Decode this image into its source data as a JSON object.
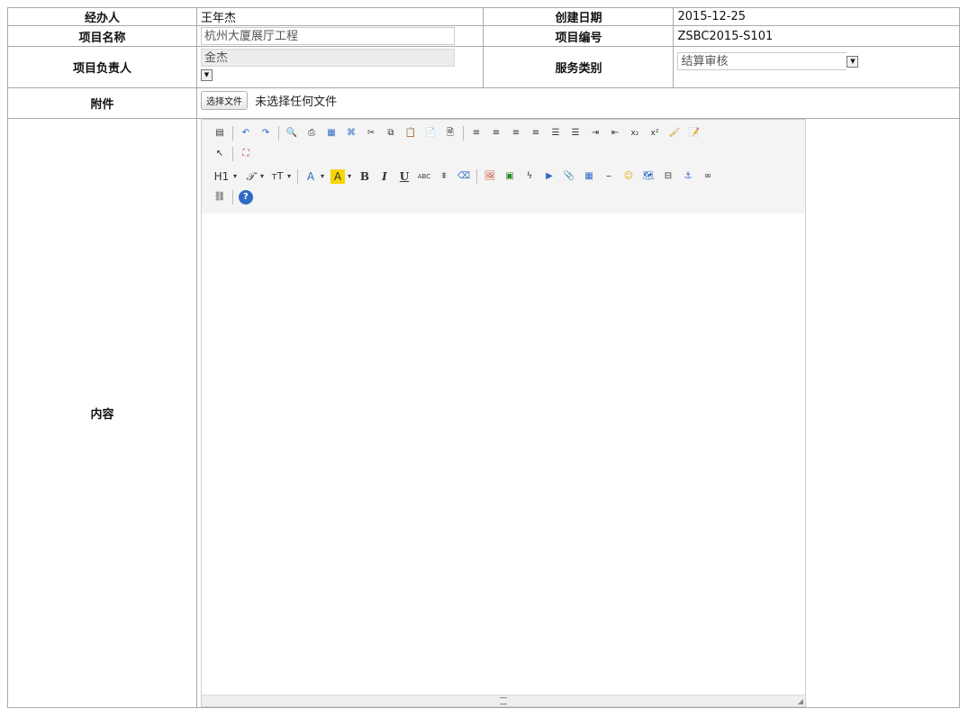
{
  "form": {
    "handler_label": "经办人",
    "handler_value": "王年杰",
    "created_label": "创建日期",
    "created_value": "2015-12-25",
    "project_name_label": "项目名称",
    "project_name_value": "杭州大厦展厅工程",
    "project_code_label": "项目编号",
    "project_code_value": "ZSBC2015-S101",
    "leader_label": "项目负责人",
    "leader_value": "金杰",
    "service_label": "服务类别",
    "service_value": "结算审核",
    "attachment_label": "附件",
    "attachment_button": "选择文件",
    "attachment_status": "未选择任何文件",
    "content_label": "内容"
  },
  "editor": {
    "toolbar_row1": [
      "source-icon",
      "undo-icon",
      "redo-icon",
      "preview-icon",
      "print-icon",
      "template-icon",
      "code-icon",
      "cut-icon",
      "copy-icon",
      "paste-icon",
      "paste-text-icon",
      "paste-word-icon",
      "align-left-icon",
      "align-center-icon",
      "align-right-icon",
      "justify-icon",
      "ordered-list-icon",
      "unordered-list-icon",
      "indent-icon",
      "outdent-icon",
      "subscript-icon",
      "superscript-icon",
      "clear-format-icon",
      "select-all-icon"
    ],
    "toolbar_row2": [
      "select-icon",
      "fullscreen-icon"
    ],
    "toolbar_row3": [
      "heading-icon",
      "font-family-icon",
      "font-size-icon",
      "font-color-icon",
      "highlight-icon",
      "bold-icon",
      "italic-icon",
      "underline-icon",
      "strikethrough-icon",
      "line-height-icon",
      "remove-format-icon",
      "image-icon",
      "multi-image-icon",
      "flash-icon",
      "media-icon",
      "insert-file-icon",
      "table-icon",
      "hr-icon",
      "emoticon-icon",
      "map-icon",
      "page-break-icon",
      "anchor-icon",
      "link-icon"
    ],
    "toolbar_row4": [
      "unlink-icon",
      "about-icon"
    ],
    "glyphs": {
      "heading": "H1",
      "font_family": "𝒯",
      "font_size": "тT",
      "font_color": "A",
      "highlight": "A",
      "bold": "B",
      "italic": "I",
      "underline": "U",
      "strikethrough": "ABC",
      "subscript": "x₂",
      "superscript": "x²"
    },
    "colors": {
      "highlight": "#f7d600",
      "accent": "#2a6fd6",
      "toolbar_bg": "#f4f4f4"
    }
  }
}
